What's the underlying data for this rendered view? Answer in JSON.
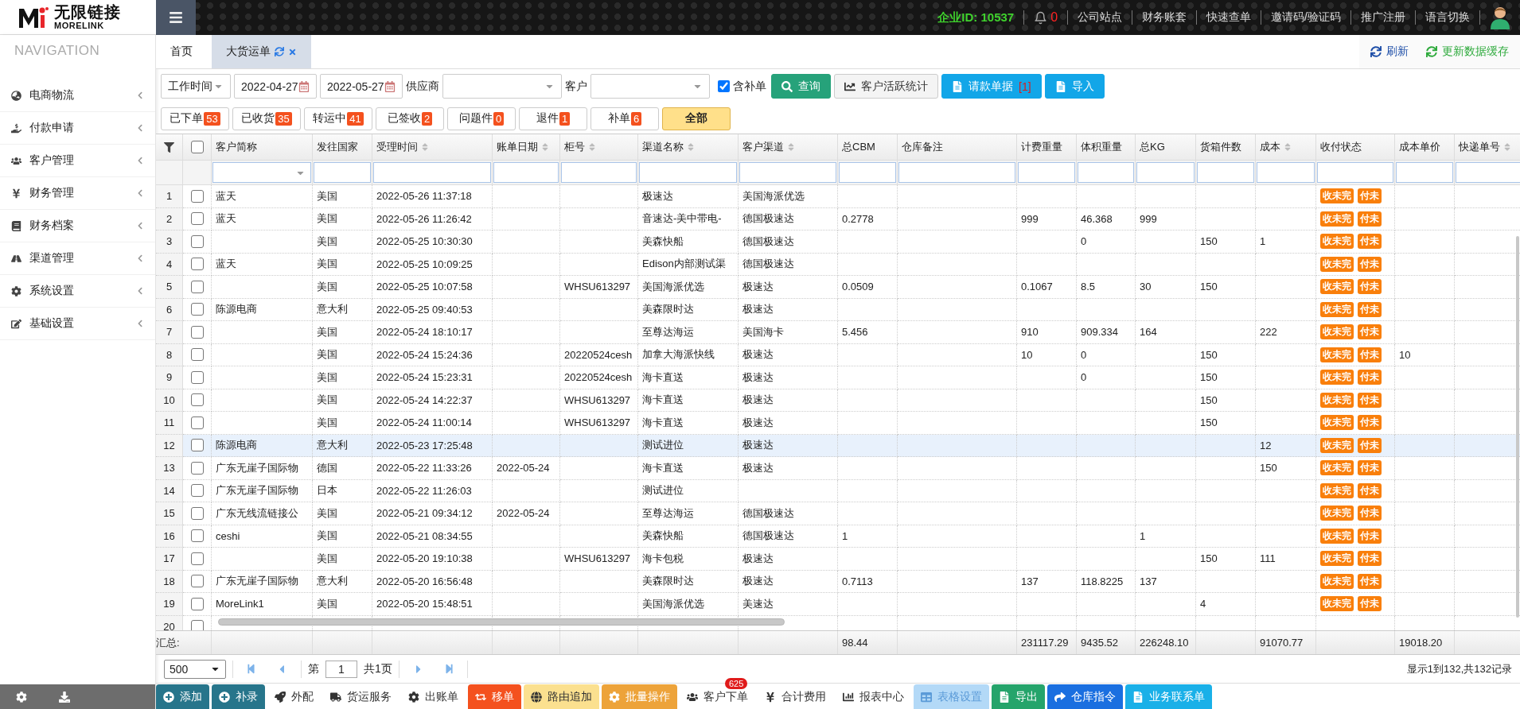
{
  "header": {
    "logo_cn": "无限链接",
    "logo_en": "MORELINK",
    "company_label": "企业ID:",
    "company_id": "10537",
    "notifications": "0",
    "links": [
      "公司站点",
      "财务账套",
      "快速查单",
      "邀请码/验证码",
      "推广注册",
      "语言切换"
    ]
  },
  "sidebar": {
    "title": "NAVIGATION",
    "items": [
      {
        "label": "电商物流"
      },
      {
        "label": "付款申请"
      },
      {
        "label": "客户管理"
      },
      {
        "label": "财务管理"
      },
      {
        "label": "财务档案"
      },
      {
        "label": "渠道管理"
      },
      {
        "label": "系统设置"
      },
      {
        "label": "基础设置"
      }
    ]
  },
  "tabs": [
    {
      "label": "首页",
      "selected": false
    },
    {
      "label": "大货运单",
      "selected": true
    }
  ],
  "tab_actions": [
    {
      "label": "刷新",
      "color": "#1f4fa8"
    },
    {
      "label": "更新数据缓存",
      "color": "#2eaa3c"
    }
  ],
  "filters": {
    "time_type": "工作时间",
    "date_from": "2022-04-27",
    "date_to": "2022-05-27",
    "supplier_label": "供应商",
    "customer_label": "客户",
    "include_label": "含补单",
    "include_checked": true
  },
  "filter_buttons": [
    {
      "label": "查询",
      "kind": "filled",
      "color": "#26a27a"
    },
    {
      "label": "客户活跃统计",
      "kind": "plain"
    },
    {
      "label": "请款单据",
      "count": "[1]",
      "kind": "filled",
      "color": "#12a6e8"
    },
    {
      "label": "导入",
      "kind": "filled",
      "color": "#12a6e8"
    }
  ],
  "status_filters": [
    {
      "label": "已下单",
      "count": "53",
      "selected": false
    },
    {
      "label": "已收货",
      "count": "35",
      "selected": false
    },
    {
      "label": "转运中",
      "count": "41",
      "selected": false
    },
    {
      "label": "已签收",
      "count": "2",
      "selected": false
    },
    {
      "label": "问题件",
      "count": "0",
      "selected": false
    },
    {
      "label": "退件",
      "count": "1",
      "selected": false
    },
    {
      "label": "补单",
      "count": "6",
      "selected": false
    },
    {
      "label": "全部",
      "selected": true
    }
  ],
  "table": {
    "header_checked": false,
    "columns": [
      {
        "label": "客户简称",
        "sortable": false,
        "kind": "select"
      },
      {
        "label": "发往国家",
        "sortable": false,
        "kind": "text"
      },
      {
        "label": "受理时间",
        "sortable": true,
        "kind": "text"
      },
      {
        "label": "账单日期",
        "sortable": true,
        "kind": "text"
      },
      {
        "label": "柜号",
        "sortable": true,
        "kind": "text"
      },
      {
        "label": "渠道名称",
        "sortable": true,
        "kind": "text"
      },
      {
        "label": "客户渠道",
        "sortable": true,
        "kind": "text"
      },
      {
        "label": "总CBM",
        "sortable": false,
        "kind": "text"
      },
      {
        "label": "仓库备注",
        "sortable": false,
        "kind": "text"
      },
      {
        "label": "计费重量",
        "sortable": false,
        "kind": "text"
      },
      {
        "label": "体积重量",
        "sortable": false,
        "kind": "text"
      },
      {
        "label": "总KG",
        "sortable": false,
        "kind": "text"
      },
      {
        "label": "货箱件数",
        "sortable": false,
        "kind": "text"
      },
      {
        "label": "成本",
        "sortable": true,
        "kind": "text"
      },
      {
        "label": "收付状态",
        "sortable": false,
        "kind": "text"
      },
      {
        "label": "成本单价",
        "sortable": false,
        "kind": "text"
      },
      {
        "label": "快递单号",
        "sortable": true,
        "kind": "text"
      }
    ],
    "rows": [
      {
        "no": "1",
        "checked": false,
        "selected": false,
        "cells": [
          "蓝天",
          "美国",
          "2022-05-26 11:37:18",
          null,
          null,
          "极速达",
          "美国海派优选",
          null,
          null,
          null,
          null,
          null,
          null,
          null,
          [
            "收未完",
            "付未"
          ],
          null,
          null
        ]
      },
      {
        "no": "2",
        "checked": false,
        "selected": false,
        "cells": [
          "蓝天",
          "美国",
          "2022-05-26 11:26:42",
          null,
          null,
          "音速达-美中带电-",
          "德国极速达",
          "0.2778",
          null,
          "999",
          "46.368",
          "999",
          null,
          null,
          [
            "收未完",
            "付未"
          ],
          null,
          null
        ]
      },
      {
        "no": "3",
        "checked": false,
        "selected": false,
        "cells": [
          null,
          "美国",
          "2022-05-25 10:30:30",
          null,
          null,
          "美森快船",
          "德国极速达",
          null,
          null,
          null,
          "0",
          null,
          "150",
          "1",
          [
            "收未完",
            "付未"
          ],
          null,
          null
        ]
      },
      {
        "no": "4",
        "checked": false,
        "selected": false,
        "cells": [
          "蓝天",
          "美国",
          "2022-05-25 10:09:25",
          null,
          null,
          "Edison内部测试渠",
          "德国极速达",
          null,
          null,
          null,
          null,
          null,
          null,
          null,
          [
            "收未完",
            "付未"
          ],
          null,
          null
        ]
      },
      {
        "no": "5",
        "checked": false,
        "selected": false,
        "cells": [
          null,
          "美国",
          "2022-05-25 10:07:58",
          null,
          "WHSU613297",
          "美国海派优选",
          "极速达",
          "0.0509",
          null,
          "0.1067",
          "8.5",
          "30",
          "150",
          null,
          [
            "收未完",
            "付未"
          ],
          null,
          null
        ]
      },
      {
        "no": "6",
        "checked": false,
        "selected": false,
        "cells": [
          "陈源电商",
          "意大利",
          "2022-05-25 09:40:53",
          null,
          null,
          "美森限时达",
          "极速达",
          null,
          null,
          null,
          null,
          null,
          null,
          null,
          [
            "收未完",
            "付未"
          ],
          null,
          null
        ]
      },
      {
        "no": "7",
        "checked": false,
        "selected": false,
        "cells": [
          null,
          "美国",
          "2022-05-24 18:10:17",
          null,
          null,
          "至尊达海运",
          "美国海卡",
          "5.456",
          null,
          "910",
          "909.334",
          "164",
          null,
          "222",
          [
            "收未完",
            "付未"
          ],
          null,
          null
        ]
      },
      {
        "no": "8",
        "checked": false,
        "selected": false,
        "cells": [
          null,
          "美国",
          "2022-05-24 15:24:36",
          null,
          "20220524cesh",
          "加拿大海派快线",
          "极速达",
          null,
          null,
          "10",
          "0",
          null,
          "150",
          null,
          [
            "收未完",
            "付未"
          ],
          "10",
          null
        ]
      },
      {
        "no": "9",
        "checked": false,
        "selected": false,
        "cells": [
          null,
          "美国",
          "2022-05-24 15:23:31",
          null,
          "20220524cesh",
          "海卡直送",
          "极速达",
          null,
          null,
          null,
          "0",
          null,
          "150",
          null,
          [
            "收未完",
            "付未"
          ],
          null,
          null
        ]
      },
      {
        "no": "10",
        "checked": false,
        "selected": false,
        "cells": [
          null,
          "美国",
          "2022-05-24 14:22:37",
          null,
          "WHSU613297",
          "海卡直送",
          "极速达",
          null,
          null,
          null,
          null,
          null,
          "150",
          null,
          [
            "收未完",
            "付未"
          ],
          null,
          null
        ]
      },
      {
        "no": "11",
        "checked": false,
        "selected": false,
        "cells": [
          null,
          "美国",
          "2022-05-24 11:00:14",
          null,
          "WHSU613297",
          "海卡直送",
          "极速达",
          null,
          null,
          null,
          null,
          null,
          "150",
          null,
          [
            "收未完",
            "付未"
          ],
          null,
          null
        ]
      },
      {
        "no": "12",
        "checked": false,
        "selected": true,
        "cells": [
          "陈源电商",
          "意大利",
          "2022-05-23 17:25:48",
          null,
          null,
          "测试进位",
          "极速达",
          null,
          null,
          null,
          null,
          null,
          null,
          "12",
          [
            "收未完",
            "付未"
          ],
          null,
          null
        ]
      },
      {
        "no": "13",
        "checked": false,
        "selected": false,
        "cells": [
          "广东无崖子国际物",
          "德国",
          "2022-05-22 11:33:26",
          "2022-05-24",
          null,
          "海卡直送",
          "极速达",
          null,
          null,
          null,
          null,
          null,
          null,
          "150",
          [
            "收未完",
            "付未"
          ],
          null,
          null
        ]
      },
      {
        "no": "14",
        "checked": false,
        "selected": false,
        "cells": [
          "广东无崖子国际物",
          "日本",
          "2022-05-22 11:26:03",
          null,
          null,
          "测试进位",
          null,
          null,
          null,
          null,
          null,
          null,
          null,
          null,
          [
            "收未完",
            "付未"
          ],
          null,
          null
        ]
      },
      {
        "no": "15",
        "checked": false,
        "selected": false,
        "cells": [
          "广东无线流链接公",
          "美国",
          "2022-05-21 09:34:12",
          "2022-05-24",
          null,
          "至尊达海运",
          "德国极速达",
          null,
          null,
          null,
          null,
          null,
          null,
          null,
          [
            "收未完",
            "付未"
          ],
          null,
          null
        ]
      },
      {
        "no": "16",
        "checked": false,
        "selected": false,
        "cells": [
          "ceshi",
          "美国",
          "2022-05-21 08:34:55",
          null,
          null,
          "美森快船",
          "德国极速达",
          "1",
          null,
          null,
          null,
          "1",
          null,
          null,
          [
            "收未完",
            "付未"
          ],
          null,
          null
        ]
      },
      {
        "no": "17",
        "checked": false,
        "selected": false,
        "cells": [
          null,
          "美国",
          "2022-05-20 19:10:38",
          null,
          "WHSU613297",
          "海卡包税",
          "极速达",
          null,
          null,
          null,
          null,
          null,
          "150",
          "111",
          [
            "收未完",
            "付未"
          ],
          null,
          null
        ]
      },
      {
        "no": "18",
        "checked": false,
        "selected": false,
        "cells": [
          "广东无崖子国际物",
          "意大利",
          "2022-05-20 16:56:48",
          null,
          null,
          "美森限时达",
          "极速达",
          "0.7113",
          null,
          "137",
          "118.8225",
          "137",
          null,
          null,
          [
            "收未完",
            "付未"
          ],
          null,
          null
        ]
      },
      {
        "no": "19",
        "checked": false,
        "selected": false,
        "cells": [
          "MoreLink1",
          "美国",
          "2022-05-20 15:48:51",
          null,
          null,
          "美国海派优选",
          "美速达",
          null,
          null,
          null,
          null,
          null,
          "4",
          null,
          [
            "收未完",
            "付未"
          ],
          null,
          null
        ]
      },
      {
        "no": "20",
        "checked": false,
        "selected": false,
        "cells": []
      }
    ],
    "summary": {
      "label": "汇总:",
      "cells": [
        null,
        null,
        null,
        null,
        null,
        null,
        null,
        "98.44",
        null,
        "231117.29",
        "9435.52",
        "226248.10",
        null,
        "91070.77",
        null,
        "19018.20",
        null
      ]
    }
  },
  "pager": {
    "page_size": "500",
    "page_label": "第",
    "page": "1",
    "total_pages": "共1页",
    "summary": "显示1到132,共132记录"
  },
  "toolbar": [
    {
      "label": "添加",
      "kind": "filled",
      "color": "#27758b"
    },
    {
      "label": "补录",
      "kind": "filled",
      "color": "#27758b"
    },
    {
      "label": "外配",
      "kind": "plain"
    },
    {
      "label": "货运服务",
      "kind": "plain"
    },
    {
      "label": "出账单",
      "kind": "plain"
    },
    {
      "label": "移单",
      "kind": "filled",
      "color": "#f4511e"
    },
    {
      "label": "路由追加",
      "kind": "light",
      "color": "#fbe08f"
    },
    {
      "label": "批量操作",
      "kind": "filled",
      "color": "#eda33a"
    },
    {
      "label": "客户下单",
      "kind": "plain",
      "badge": "625"
    },
    {
      "label": "合计费用",
      "kind": "plain"
    },
    {
      "label": "报表中心",
      "kind": "plain"
    },
    {
      "label": "表格设置",
      "kind": "faded",
      "color": "#b3d9f7"
    },
    {
      "label": "导出",
      "kind": "filled",
      "color": "#25a46b"
    },
    {
      "label": "仓库指令",
      "kind": "filled",
      "color": "#1a6fe0"
    },
    {
      "label": "业务联系单",
      "kind": "filled",
      "color": "#1ab0e8"
    }
  ]
}
